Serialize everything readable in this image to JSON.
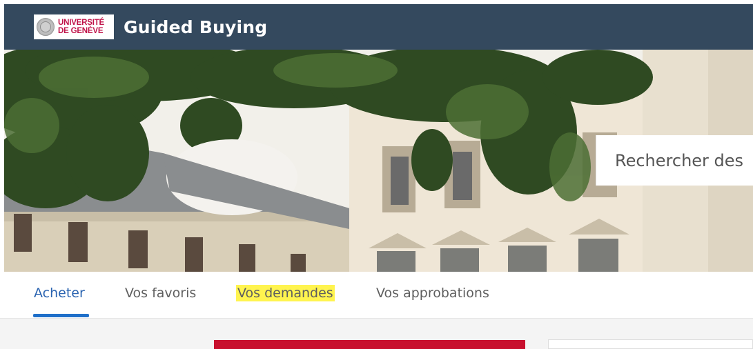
{
  "header": {
    "logo_line1": "UNIVERSITÉ",
    "logo_line2": "DE GENÈVE",
    "logo_icon": "university-seal-icon",
    "title": "Guided Buying",
    "bar_color": "#34495e",
    "brand_color": "#c0144a"
  },
  "search": {
    "placeholder": "Rechercher des"
  },
  "tabs": [
    {
      "label": "Acheter",
      "active": true
    },
    {
      "label": "Vos favoris",
      "active": false
    },
    {
      "label": "Vos demandes",
      "active": false,
      "highlighted": true
    },
    {
      "label": "Vos approbations",
      "active": false
    }
  ],
  "colors": {
    "active_tab": "#2b64b1",
    "tab_underline": "#1f6fc9",
    "highlight": "#fff44f",
    "banner_red": "#c8102e"
  }
}
